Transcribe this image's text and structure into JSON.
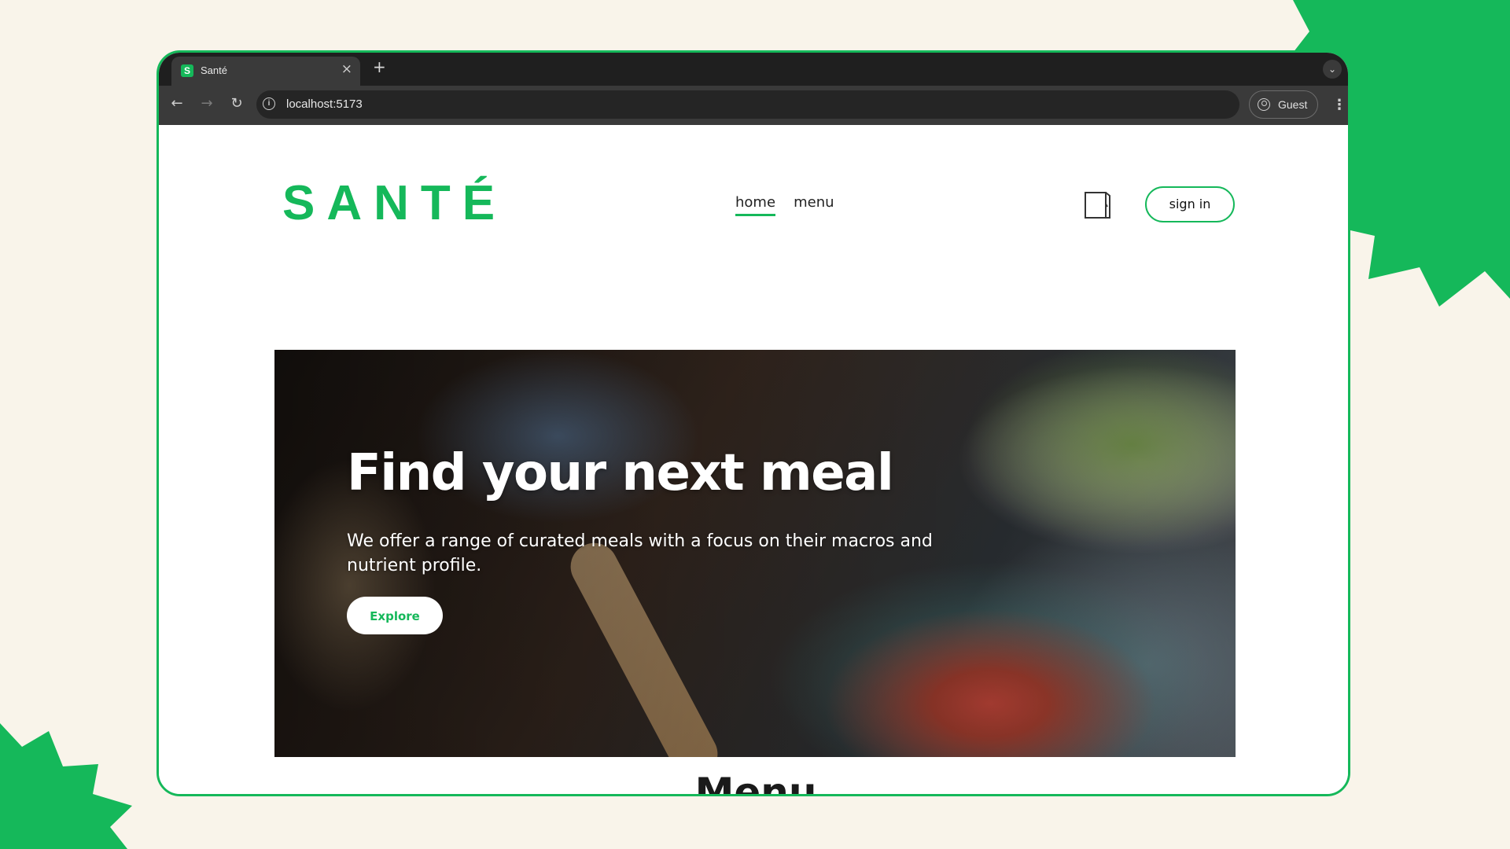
{
  "colors": {
    "brand": "#15b85a",
    "background": "#f9f4ea",
    "browser_dark": "#1f1f1f"
  },
  "browser": {
    "tab": {
      "favicon_letter": "S",
      "title": "Santé",
      "close_icon": "close-icon"
    },
    "new_tab_symbol": "+",
    "url": "localhost:5173",
    "profile_label": "Guest"
  },
  "site": {
    "logo": "SANTÉ",
    "nav": [
      {
        "label": "home",
        "active": true
      },
      {
        "label": "menu",
        "active": false
      }
    ],
    "cart_icon": "shopping-bag-icon",
    "signin_label": "sign in",
    "hero": {
      "title": "Find your next meal",
      "subtitle": "We offer a range of curated meals with a focus on their macros and nutrient profile.",
      "cta_label": "Explore"
    },
    "section_heading": "Menu"
  }
}
